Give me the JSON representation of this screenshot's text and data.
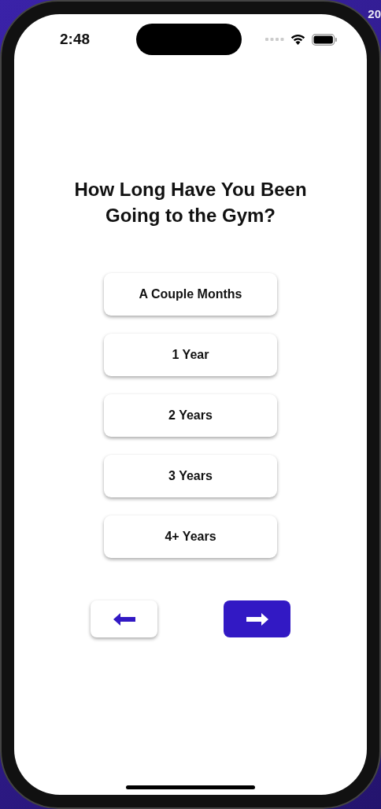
{
  "desktop_edge_text": [
    "20"
  ],
  "status_bar": {
    "time": "2:48"
  },
  "title_lines": [
    "How Long Have You Been",
    "Going to the Gym?"
  ],
  "options": [
    {
      "label": "A Couple Months"
    },
    {
      "label": "1 Year"
    },
    {
      "label": "2 Years"
    },
    {
      "label": "3 Years"
    },
    {
      "label": "4+ Years"
    }
  ],
  "nav_buttons": [
    {
      "kind": "back"
    },
    {
      "kind": "next"
    }
  ]
}
